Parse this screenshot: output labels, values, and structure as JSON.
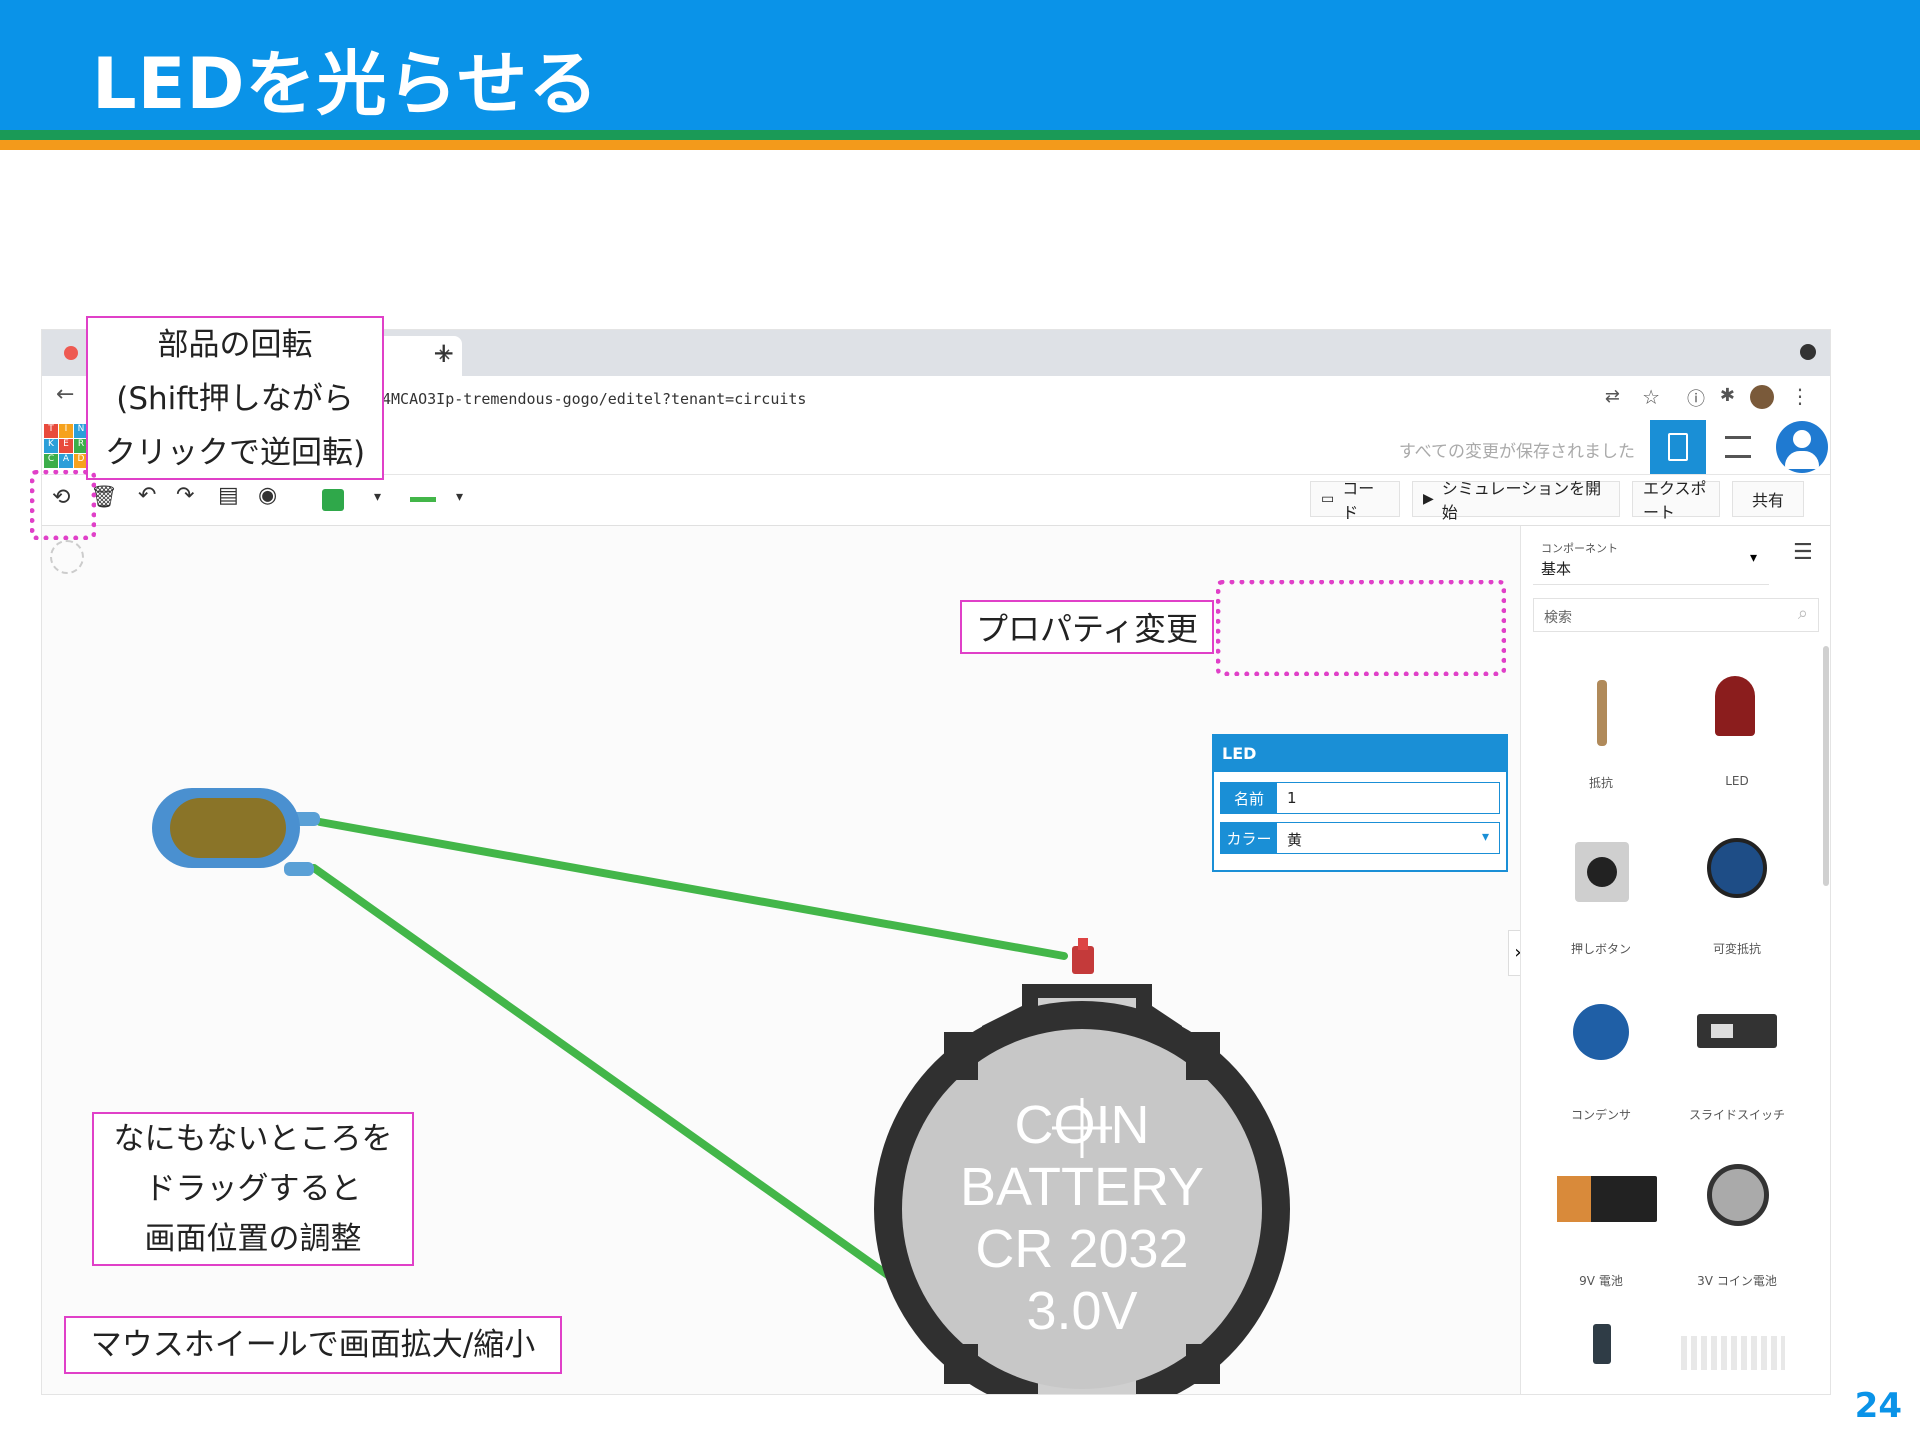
{
  "slide": {
    "title": "LEDを光らせる",
    "page_number": "24"
  },
  "browser": {
    "new_tab": "+",
    "tab_close": "×",
    "url": "4MCAO3Ip-tremendous-gogo/editel?tenant=circuits"
  },
  "app": {
    "logo_letters": [
      "T",
      "I",
      "N",
      "K",
      "E",
      "R",
      "C",
      "A",
      "D"
    ],
    "saved_status": "すべての変更が保存されました"
  },
  "toolbar": {
    "code_label": "コード",
    "simulate_label": "シミュレーションを開始",
    "export_label": "エクスポート",
    "share_label": "共有",
    "fill_color": "#2fa84a"
  },
  "properties": {
    "header": "LED",
    "name_label": "名前",
    "name_value": "1",
    "color_label": "カラー",
    "color_value": "黄"
  },
  "components": {
    "category_label": "コンポーネント",
    "category_value": "基本",
    "search_placeholder": "検索",
    "items": [
      {
        "label": "抵抗",
        "icon": "resistor-icon"
      },
      {
        "label": "LED",
        "icon": "led-icon"
      },
      {
        "label": "押しボタン",
        "icon": "pushbutton-icon"
      },
      {
        "label": "可変抵抗",
        "icon": "potentiometer-icon"
      },
      {
        "label": "コンデンサ",
        "icon": "capacitor-icon"
      },
      {
        "label": "スライドスイッチ",
        "icon": "slide-switch-icon"
      },
      {
        "label": "9V 電池",
        "icon": "battery-9v-icon"
      },
      {
        "label": "3V コイン電池",
        "icon": "coin-battery-icon"
      }
    ]
  },
  "battery": {
    "line1": "COIN BATTERY",
    "line2": "CR 2032",
    "line3": "3.0V"
  },
  "callouts": {
    "rotate_line1": "部品の回転",
    "rotate_line2": "(Shift押しながら",
    "rotate_line3": "クリックで逆回転)",
    "property_change": "プロパティ変更",
    "drag_line1": "なにもないところを",
    "drag_line2": "ドラッグすると",
    "drag_line3": "画面位置の調整",
    "zoom": "マウスホイールで画面拡大/縮小"
  },
  "colors": {
    "header_blue": "#0a93e8",
    "stripe_green": "#1a9a57",
    "stripe_orange": "#f39a1b",
    "callout_magenta": "#e040c8",
    "wire_green": "#43b649",
    "led_yellow": "#8a7428"
  }
}
